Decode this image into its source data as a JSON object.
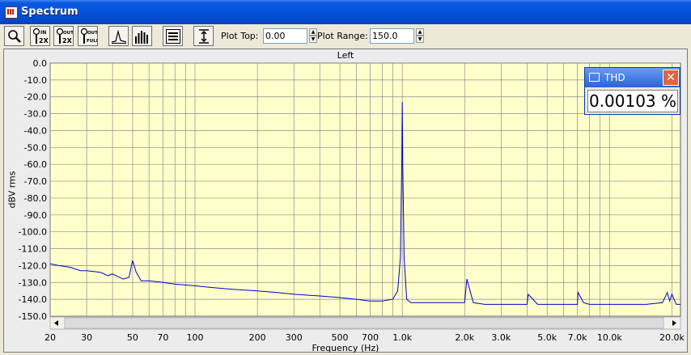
{
  "window": {
    "title": "Spectrum"
  },
  "toolbar": {
    "buttons": [
      {
        "name": "zoom-magnifier-button",
        "icon": "magnifier-icon"
      },
      {
        "name": "zoom-in-2x-button",
        "icon": "zoom-in-2x-icon",
        "text": "IN 2X"
      },
      {
        "name": "zoom-out-2x-button",
        "icon": "zoom-out-2x-icon",
        "text": "OUT 2X"
      },
      {
        "name": "zoom-out-full-button",
        "icon": "zoom-out-full-icon",
        "text": "OUT FULL"
      },
      {
        "name": "line-graph-button",
        "icon": "line-graph-icon"
      },
      {
        "name": "bar-graph-button",
        "icon": "bar-graph-icon"
      },
      {
        "name": "settings-panel-button",
        "icon": "panel-icon"
      },
      {
        "name": "autoscale-button",
        "icon": "vertical-scale-icon"
      }
    ],
    "plot_top_label": "Plot Top:",
    "plot_top_value": "0.00",
    "plot_range_label": "Plot Range:",
    "plot_range_value": "150.0"
  },
  "thd_window": {
    "title": "THD",
    "value": "0.00103 %"
  },
  "colors": {
    "plot_bg": "#ffffcc",
    "trace": "#0000cc",
    "titlebar": "#0552d8"
  },
  "chart_data": {
    "type": "line",
    "title": "Left",
    "xlabel": "Frequency (Hz)",
    "ylabel": "dBV rms",
    "x_scale": "log",
    "xlim": [
      20,
      22000
    ],
    "ylim": [
      -150,
      0
    ],
    "x_ticks": [
      20,
      30,
      50,
      70,
      100,
      200,
      300,
      500,
      700,
      1000,
      2000,
      3000,
      5000,
      7000,
      10000,
      20000
    ],
    "x_tick_labels": [
      "20",
      "30",
      "50",
      "70",
      "100",
      "200",
      "300",
      "500",
      "700",
      "1.0k",
      "2.0k",
      "3.0k",
      "5.0k",
      "7.0k",
      "10.0k",
      "20.0k"
    ],
    "y_ticks": [
      0,
      -10,
      -20,
      -30,
      -40,
      -50,
      -60,
      -70,
      -80,
      -90,
      -100,
      -110,
      -120,
      -130,
      -140,
      -150
    ],
    "y_tick_labels": [
      "0.0",
      "-10.0",
      "-20.0",
      "-30.0",
      "-40.0",
      "-50.0",
      "-60.0",
      "-70.0",
      "-80.0",
      "-90.0",
      "-100.0",
      "-110.0",
      "-120.0",
      "-130.0",
      "-140.0",
      "-150.0"
    ],
    "grid": true,
    "series": [
      {
        "x": [
          20,
          22,
          25,
          28,
          30,
          35,
          38,
          40,
          45,
          48,
          50,
          52,
          55,
          60,
          70,
          80,
          100,
          120,
          150,
          200,
          250,
          300,
          400,
          500,
          600,
          700,
          800,
          900,
          950,
          980,
          995,
          1000,
          1005,
          1020,
          1050,
          1100,
          1300,
          1500,
          1800,
          2000,
          2050,
          2200,
          2500,
          3000,
          3500,
          4000,
          4050,
          4500,
          5000,
          6000,
          7000,
          7050,
          7500,
          8000,
          9000,
          10000,
          12000,
          15000,
          18000,
          19000,
          19500,
          20000,
          21000,
          22000
        ],
        "y": [
          -119,
          -120,
          -121,
          -123,
          -123,
          -124,
          -126,
          -125,
          -128,
          -127,
          -117,
          -124,
          -129,
          -129,
          -130,
          -131,
          -132,
          -133,
          -134,
          -135,
          -136,
          -137,
          -138,
          -139,
          -140,
          -141,
          -141,
          -140,
          -135,
          -115,
          -57,
          -23,
          -57,
          -115,
          -140,
          -142,
          -142,
          -142,
          -142,
          -142,
          -128,
          -142,
          -143,
          -143,
          -143,
          -143,
          -137,
          -143,
          -143,
          -143,
          -143,
          -136,
          -142,
          -143,
          -143,
          -143,
          -143,
          -143,
          -142,
          -136,
          -141,
          -137,
          -143,
          -143
        ]
      }
    ]
  }
}
